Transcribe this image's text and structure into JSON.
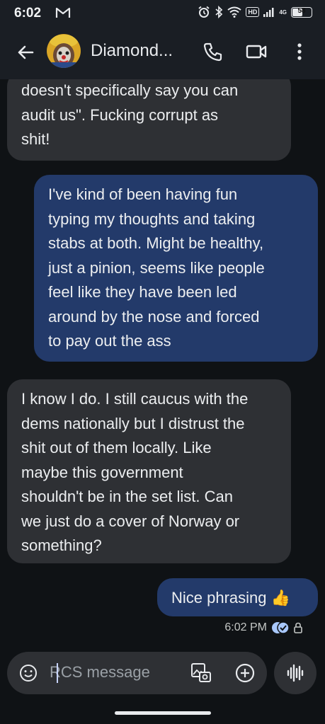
{
  "status_bar": {
    "time": "6:02",
    "hd": "HD",
    "network": "4G",
    "battery": "58",
    "battery_level": 0.58
  },
  "header": {
    "contact_name": "Diamond...",
    "back_icon": "arrow-back-icon",
    "call_icon": "phone-icon",
    "video_icon": "videocam-icon",
    "menu_icon": "more-vert-icon"
  },
  "messages": [
    {
      "direction": "incoming",
      "lines": [
        "doesn't specifically say you can",
        "audit us\". Fucking corrupt as",
        "shit!"
      ]
    },
    {
      "direction": "outgoing",
      "lines": [
        "I've kind of been having fun",
        "typing my thoughts and taking",
        "stabs at both. Might be healthy,",
        "just a pinion, seems like people",
        "feel like they have been led",
        "around by the nose and forced",
        "to pay out the ass"
      ]
    },
    {
      "direction": "incoming",
      "lines": [
        "I know I do. I still caucus with the",
        "dems nationally but I distrust the",
        "shit out of them locally. Like",
        "maybe this government",
        "shouldn't be in the set list. Can",
        "we just do a cover of Norway or",
        "something?"
      ]
    },
    {
      "direction": "outgoing",
      "text": "Nice phrasing 👍"
    }
  ],
  "last_message_meta": {
    "time": "6:02 PM",
    "status_icon": "read-receipt-icon",
    "lock_icon": "lock-icon"
  },
  "composer": {
    "placeholder": "RCS message",
    "emoji_icon": "emoji-icon",
    "gallery_icon": "gallery-icon",
    "add_icon": "add-circle-icon",
    "voice_icon": "voice-waveform-icon"
  },
  "colors": {
    "background": "#0f1215",
    "app_bar": "#1a1e24",
    "incoming_bubble": "#2e3034",
    "outgoing_bubble": "#233a6a",
    "read_receipt": "#a8c7fa"
  }
}
